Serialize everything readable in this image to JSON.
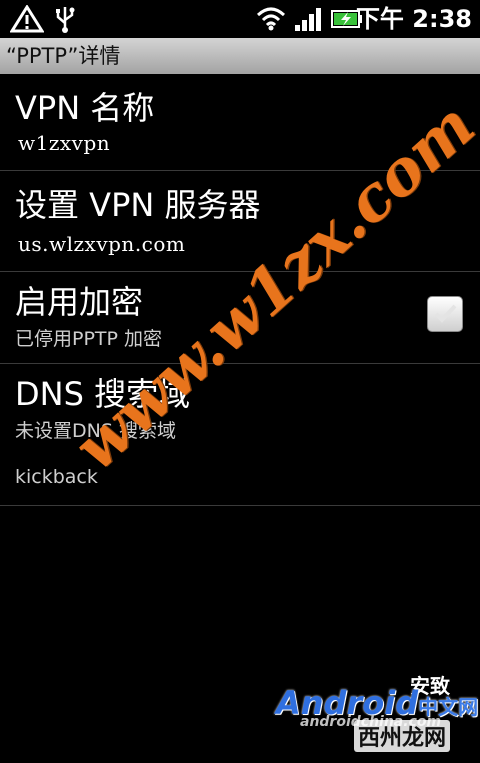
{
  "status_bar": {
    "time": "下午 2:38",
    "icons": [
      "alert-icon",
      "usb-icon",
      "wifi-icon",
      "signal-icon",
      "battery-charging-icon"
    ]
  },
  "title_bar": {
    "title": "“PPTP”详情"
  },
  "settings": [
    {
      "title": "VPN 名称",
      "value": "w1zxvpn"
    },
    {
      "title": "设置 VPN 服务器",
      "value": "us.wlzxvpn.com"
    },
    {
      "title": "启用加密",
      "summary": "已停用PPTP 加密",
      "checked": true
    },
    {
      "title": "DNS 搜索域",
      "summary": "未设置DNS 搜索域",
      "extra": "kickback"
    }
  ],
  "watermark": {
    "text": "www.w1zx.com"
  },
  "logo": {
    "top": "安致",
    "main": "Android",
    "main_cn": "中文网",
    "sub": "androidchina.com",
    "stamp": "西州龙网"
  }
}
